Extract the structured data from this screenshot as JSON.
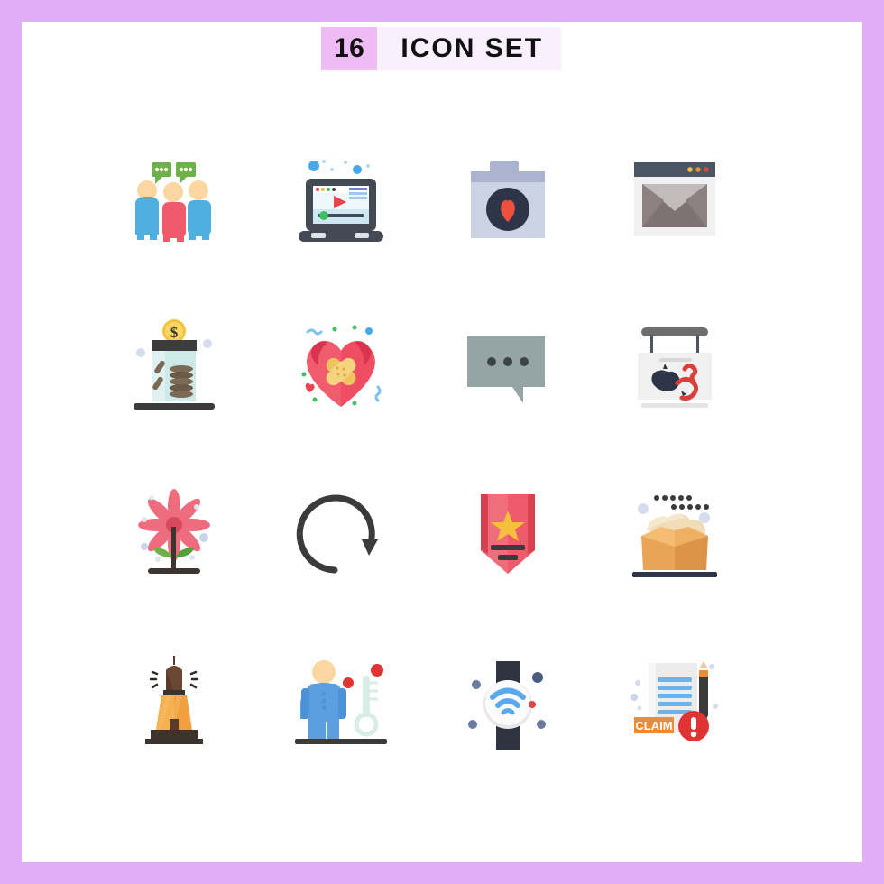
{
  "page": {
    "background_color": "#e0aef7",
    "canvas_color": "#ffffff"
  },
  "header": {
    "count": "16",
    "title": "ICON SET",
    "count_bg": "#eebbf5",
    "title_bg": "#faeffc",
    "text_color": "#111111"
  },
  "grid": {
    "columns": 4,
    "rows": 4,
    "total_icons": 16
  },
  "icons": [
    {
      "index": 1,
      "name": "group-discussion-icon",
      "label": "Group of three people with speech bubbles",
      "colors": [
        "#4fb0e0",
        "#ef5b6b",
        "#f9d5a0",
        "#6db14a"
      ]
    },
    {
      "index": 2,
      "name": "laptop-video-player-icon",
      "label": "Laptop playing video",
      "colors": [
        "#434a54",
        "#e8f4fb",
        "#e8434f",
        "#3fbf5f"
      ]
    },
    {
      "index": 3,
      "name": "camera-favorite-icon",
      "label": "Camera with heart in lens",
      "colors": [
        "#ccd3e3",
        "#aab4ce",
        "#2e3548",
        "#f04e3e"
      ]
    },
    {
      "index": 4,
      "name": "browser-email-icon",
      "label": "Browser window with envelope",
      "colors": [
        "#4b5563",
        "#f0f0f0",
        "#7d7375",
        "#c3babb"
      ]
    },
    {
      "index": 5,
      "name": "money-jar-icon",
      "label": "Savings jar with dollar coin",
      "colors": [
        "#cdeae8",
        "#3c3c3c",
        "#f2c43d",
        "#5b4a3c"
      ]
    },
    {
      "index": 6,
      "name": "heart-bandage-icon",
      "label": "Heart with crossed bandages",
      "colors": [
        "#ef4d62",
        "#d8344e",
        "#f5d47d",
        "#efc35f"
      ]
    },
    {
      "index": 7,
      "name": "chat-bubble-dots-icon",
      "label": "Speech bubble with three dots",
      "colors": [
        "#95a5a5",
        "#3b444b"
      ]
    },
    {
      "index": 8,
      "name": "australia-map-sign-icon",
      "label": "Hanging sign with Australia map",
      "colors": [
        "#f0f0f0",
        "#6e6e6e",
        "#2e3548",
        "#d8403c"
      ]
    },
    {
      "index": 9,
      "name": "flower-plant-icon",
      "label": "Pink flower with leaves",
      "colors": [
        "#ef6b7e",
        "#d8495e",
        "#6db14a",
        "#3c3530"
      ]
    },
    {
      "index": 10,
      "name": "refresh-arrow-icon",
      "label": "Circular refresh arrow",
      "colors": [
        "#3b3b3b"
      ]
    },
    {
      "index": 11,
      "name": "rank-badge-star-icon",
      "label": "Red badge with gold star",
      "colors": [
        "#ef5b6b",
        "#d8404f",
        "#f5c03d",
        "#3b3b3b"
      ]
    },
    {
      "index": 12,
      "name": "open-box-icon",
      "label": "Open cardboard box with contents",
      "colors": [
        "#f0b064",
        "#e8c78f",
        "#f0ddb8",
        "#2e3548"
      ]
    },
    {
      "index": 13,
      "name": "lighthouse-icon",
      "label": "Lighthouse with beacon",
      "colors": [
        "#f0a03c",
        "#5b3a2a",
        "#3b332c"
      ]
    },
    {
      "index": 14,
      "name": "sick-person-fever-icon",
      "label": "Person with thermometer and fever spots",
      "colors": [
        "#5b9fe0",
        "#f9d5a0",
        "#e03434",
        "#d8ece8"
      ]
    },
    {
      "index": 15,
      "name": "smartwatch-wifi-icon",
      "label": "Smartwatch showing wifi signal",
      "colors": [
        "#2e3340",
        "#f2f2f2",
        "#5aa9ef",
        "#e04545"
      ]
    },
    {
      "index": 16,
      "name": "claim-document-icon",
      "label": "Document with CLAIM label, pencil and alert",
      "colors": [
        "#ececec",
        "#6eb3e8",
        "#ef8b34",
        "#e03434"
      ]
    }
  ]
}
